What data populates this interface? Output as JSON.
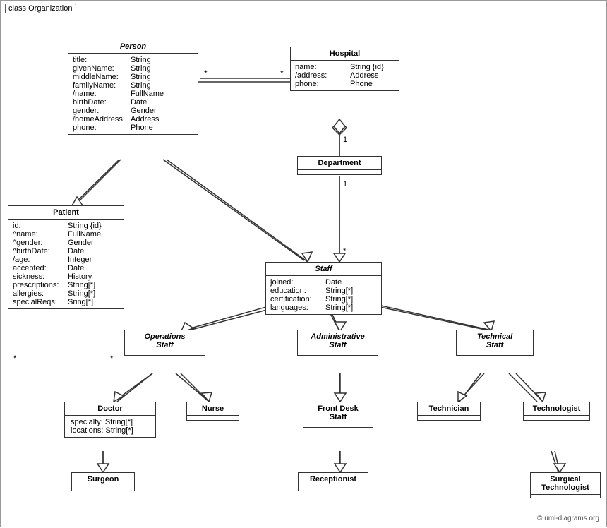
{
  "diagram": {
    "title": "class Organization",
    "classes": {
      "person": {
        "name": "Person",
        "italic": true,
        "attrs": [
          {
            "name": "title:",
            "type": "String"
          },
          {
            "name": "givenName:",
            "type": "String"
          },
          {
            "name": "middleName:",
            "type": "String"
          },
          {
            "name": "familyName:",
            "type": "String"
          },
          {
            "name": "/name:",
            "type": "FullName"
          },
          {
            "name": "birthDate:",
            "type": "Date"
          },
          {
            "name": "gender:",
            "type": "Gender"
          },
          {
            "name": "/homeAddress:",
            "type": "Address"
          },
          {
            "name": "phone:",
            "type": "Phone"
          }
        ]
      },
      "hospital": {
        "name": "Hospital",
        "attrs": [
          {
            "name": "name:",
            "type": "String {id}"
          },
          {
            "name": "/address:",
            "type": "Address"
          },
          {
            "name": "phone:",
            "type": "Phone"
          }
        ]
      },
      "patient": {
        "name": "Patient",
        "attrs": [
          {
            "name": "id:",
            "type": "String {id}"
          },
          {
            "name": "^name:",
            "type": "FullName"
          },
          {
            "name": "^gender:",
            "type": "Gender"
          },
          {
            "name": "^birthDate:",
            "type": "Date"
          },
          {
            "name": "/age:",
            "type": "Integer"
          },
          {
            "name": "accepted:",
            "type": "Date"
          },
          {
            "name": "sickness:",
            "type": "History"
          },
          {
            "name": "prescriptions:",
            "type": "String[*]"
          },
          {
            "name": "allergies:",
            "type": "String[*]"
          },
          {
            "name": "specialReqs:",
            "type": "Sring[*]"
          }
        ]
      },
      "department": {
        "name": "Department",
        "simple": true
      },
      "staff": {
        "name": "Staff",
        "italic": true,
        "attrs": [
          {
            "name": "joined:",
            "type": "Date"
          },
          {
            "name": "education:",
            "type": "String[*]"
          },
          {
            "name": "certification:",
            "type": "String[*]"
          },
          {
            "name": "languages:",
            "type": "String[*]"
          }
        ]
      },
      "operations_staff": {
        "name": "Operations Staff",
        "italic": true,
        "simple": true
      },
      "administrative_staff": {
        "name": "Administrative Staff",
        "italic": true,
        "simple": true
      },
      "technical_staff": {
        "name": "Technical Staff",
        "italic": true,
        "simple": true
      },
      "doctor": {
        "name": "Doctor",
        "attrs": [
          {
            "name": "specialty:",
            "type": "String[*]"
          },
          {
            "name": "locations:",
            "type": "String[*]"
          }
        ]
      },
      "nurse": {
        "name": "Nurse",
        "simple": true
      },
      "front_desk_staff": {
        "name": "Front Desk Staff",
        "simple": true
      },
      "technician": {
        "name": "Technician",
        "simple": true
      },
      "technologist": {
        "name": "Technologist",
        "simple": true
      },
      "surgeon": {
        "name": "Surgeon",
        "simple": true
      },
      "receptionist": {
        "name": "Receptionist",
        "simple": true
      },
      "surgical_technologist": {
        "name": "Surgical Technologist",
        "simple": true
      }
    },
    "copyright": "© uml-diagrams.org"
  }
}
